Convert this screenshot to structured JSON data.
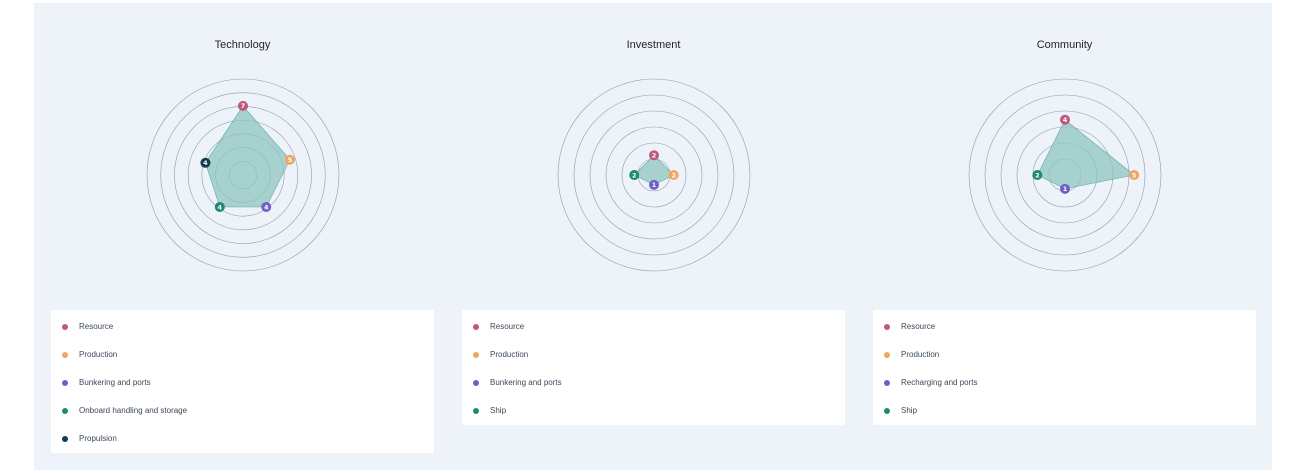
{
  "colors": {
    "resource": "#c0587c",
    "production": "#f0a660",
    "bunkering": "#6f5fc7",
    "onboard": "#1f8a73",
    "propulsion": "#143c4f",
    "fill": "#8fc5c0",
    "ring": "#6e7fa0"
  },
  "chart_data": [
    {
      "type": "radar",
      "title": "Technology",
      "max": 7,
      "rings": 7,
      "categories": [
        "Resource",
        "Production",
        "Bunkering and ports",
        "Onboard handling and storage",
        "Propulsion"
      ],
      "values": [
        7,
        5,
        4,
        4,
        4
      ],
      "colors": [
        "#c0587c",
        "#f0a660",
        "#6f5fc7",
        "#1f8a73",
        "#143c4f"
      ],
      "grid": true
    },
    {
      "type": "radar",
      "title": "Investment",
      "max": 7,
      "rings": 6,
      "categories": [
        "Resource",
        "Production",
        "Bunkering and ports",
        "Ship"
      ],
      "values": [
        2,
        2,
        1,
        2
      ],
      "colors": [
        "#c0587c",
        "#f0a660",
        "#6f5fc7",
        "#1f8a73"
      ],
      "grid": true
    },
    {
      "type": "radar",
      "title": "Community",
      "max": 5,
      "rings": 6,
      "categories": [
        "Resource",
        "Production",
        "Recharging and ports",
        "Ship"
      ],
      "values": [
        4,
        5,
        1,
        2
      ],
      "colors": [
        "#c0587c",
        "#f0a660",
        "#6f5fc7",
        "#1f8a73"
      ],
      "grid": true
    }
  ]
}
